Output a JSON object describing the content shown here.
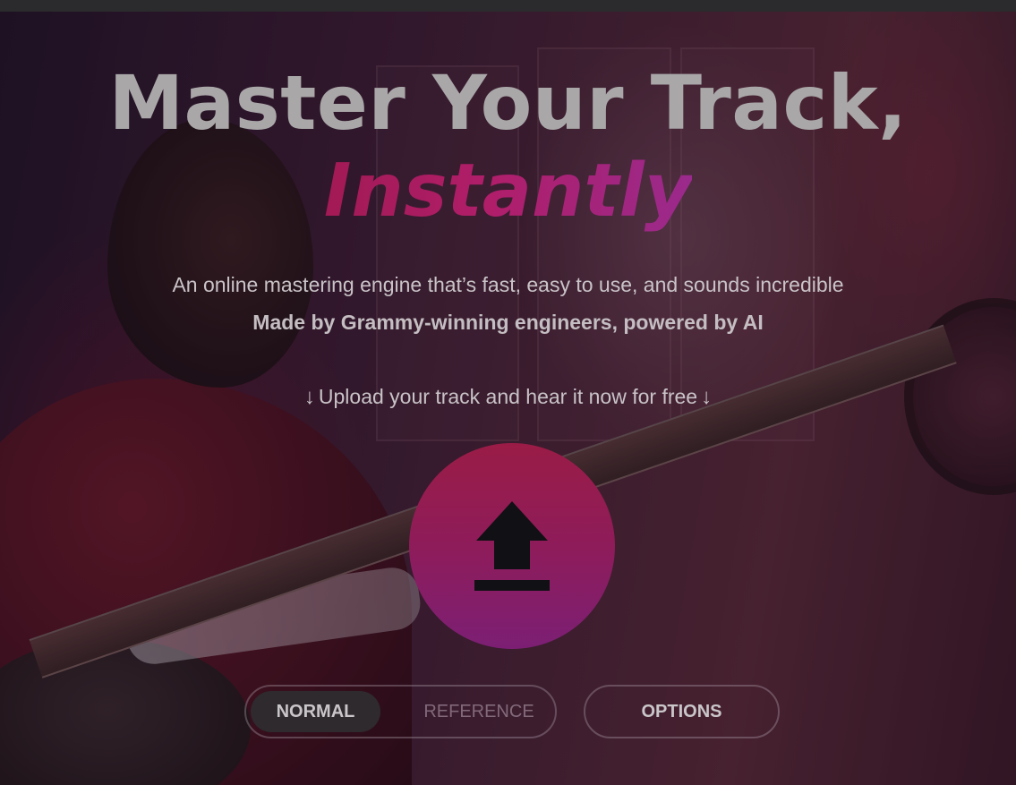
{
  "hero": {
    "title_line1": "Master Your Track,",
    "title_line2": "Instantly",
    "subtitle": "An online mastering engine that’s fast, easy to use, and sounds incredible",
    "tagline": "Made by Grammy-winning engineers, powered by AI",
    "cta_text": "Upload your track and hear it now for free",
    "cta_arrow": "↓"
  },
  "upload": {
    "icon": "upload-arrow-icon",
    "button_color_top": "#9a1c46",
    "button_color_bottom": "#7c1f74"
  },
  "mode": {
    "options": [
      "NORMAL",
      "REFERENCE"
    ],
    "selected": "NORMAL"
  },
  "options_button": {
    "label": "OPTIONS"
  },
  "colors": {
    "title": "#a9a7a8",
    "accent_start": "#a21a55",
    "accent_end": "#9a2a8c"
  }
}
